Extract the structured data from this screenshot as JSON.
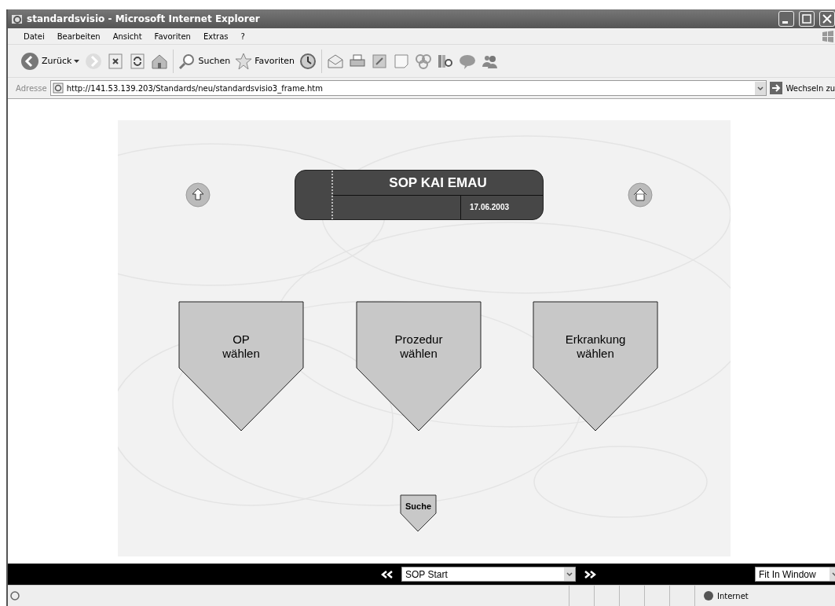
{
  "window": {
    "title": "standardsvisio - Microsoft Internet Explorer"
  },
  "menu": [
    "Datei",
    "Bearbeiten",
    "Ansicht",
    "Favoriten",
    "Extras",
    "?"
  ],
  "toolbar": {
    "back": "Zurück",
    "search": "Suchen",
    "favorites": "Favoriten"
  },
  "address": {
    "label": "Adresse",
    "url": "http://141.53.139.203/Standards/neu/standardsvisio3_frame.htm",
    "go": "Wechseln zu"
  },
  "page": {
    "title": "SOP KAI EMAU",
    "date": "17.06.2003",
    "search": "Suche",
    "choices": [
      {
        "text": "OP\nwählen"
      },
      {
        "text": "Prozedur\nwählen"
      },
      {
        "text": "Erkrankung\nwählen"
      }
    ]
  },
  "nav_bar": {
    "page_select": "SOP Start",
    "zoom_select": "Fit In Window"
  },
  "status_bar": {
    "zone": "Internet"
  }
}
